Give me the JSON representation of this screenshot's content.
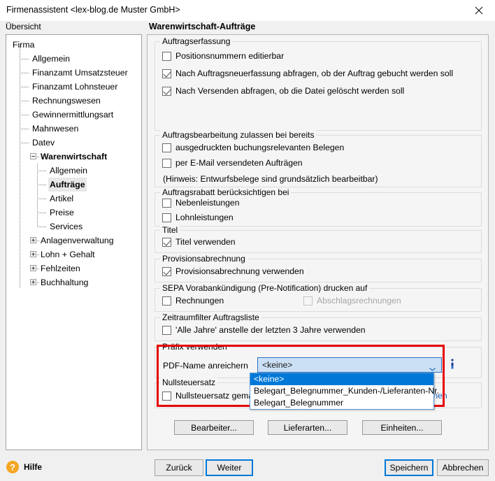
{
  "window": {
    "title": "Firmenassistent <lex-blog.de Muster GmbH>",
    "close_icon": "close-icon"
  },
  "sidebar": {
    "header": "Übersicht",
    "items": [
      {
        "label": "Firma",
        "level": 0,
        "expander": "none",
        "bold": false,
        "selected": false
      },
      {
        "label": "Allgemein",
        "level": 1,
        "expander": "none",
        "bold": false,
        "selected": false
      },
      {
        "label": "Finanzamt Umsatzsteuer",
        "level": 1,
        "expander": "none",
        "bold": false,
        "selected": false
      },
      {
        "label": "Finanzamt Lohnsteuer",
        "level": 1,
        "expander": "none",
        "bold": false,
        "selected": false
      },
      {
        "label": "Rechnungswesen",
        "level": 1,
        "expander": "none",
        "bold": false,
        "selected": false
      },
      {
        "label": "Gewinnermittlungsart",
        "level": 1,
        "expander": "none",
        "bold": false,
        "selected": false
      },
      {
        "label": "Mahnwesen",
        "level": 1,
        "expander": "none",
        "bold": false,
        "selected": false
      },
      {
        "label": "Datev",
        "level": 1,
        "expander": "none",
        "bold": false,
        "selected": false
      },
      {
        "label": "Warenwirtschaft",
        "level": 1,
        "expander": "minus",
        "bold": true,
        "selected": false
      },
      {
        "label": "Allgemein",
        "level": 2,
        "expander": "none",
        "bold": false,
        "selected": false
      },
      {
        "label": "Aufträge",
        "level": 2,
        "expander": "none",
        "bold": true,
        "selected": true
      },
      {
        "label": "Artikel",
        "level": 2,
        "expander": "none",
        "bold": false,
        "selected": false
      },
      {
        "label": "Preise",
        "level": 2,
        "expander": "none",
        "bold": false,
        "selected": false
      },
      {
        "label": "Services",
        "level": 2,
        "expander": "none",
        "bold": false,
        "selected": false
      },
      {
        "label": "Anlagenverwaltung",
        "level": 1,
        "expander": "plus",
        "bold": false,
        "selected": false
      },
      {
        "label": "Lohn + Gehalt",
        "level": 1,
        "expander": "plus",
        "bold": false,
        "selected": false
      },
      {
        "label": "Fehlzeiten",
        "level": 1,
        "expander": "plus",
        "bold": false,
        "selected": false
      },
      {
        "label": "Buchhaltung",
        "level": 1,
        "expander": "plus",
        "bold": false,
        "selected": false
      }
    ]
  },
  "page": {
    "title": "Warenwirtschaft-Aufträge"
  },
  "groups": {
    "auftragserfassung": {
      "title": "Auftragserfassung",
      "options": [
        {
          "label": "Positionsnummern editierbar",
          "checked": false,
          "disabled": false
        },
        {
          "label": "Nach Auftragsneuerfassung abfragen, ob der Auftrag gebucht werden soll",
          "checked": true,
          "disabled": false
        },
        {
          "label": "Nach Versenden abfragen, ob die Datei gelöscht werden soll",
          "checked": true,
          "disabled": false
        }
      ]
    },
    "auftragsbearbeitung": {
      "title": "Auftragsbearbeitung zulassen bei bereits",
      "options": [
        {
          "label": "ausgedruckten buchungsrelevanten Belegen",
          "checked": false,
          "disabled": false
        },
        {
          "label": "per E-Mail versendeten Aufträgen",
          "checked": false,
          "disabled": false
        }
      ],
      "note": "(Hinweis: Entwurfsbelege sind grundsätzlich bearbeitbar)"
    },
    "auftragsrabatt": {
      "title": "Auftragsrabatt berücksichtigen bei",
      "options": [
        {
          "label": "Nebenleistungen",
          "checked": false,
          "disabled": false
        },
        {
          "label": "Lohnleistungen",
          "checked": false,
          "disabled": false
        }
      ]
    },
    "titel": {
      "title": "Titel",
      "options": [
        {
          "label": "Titel verwenden",
          "checked": true,
          "disabled": false
        }
      ]
    },
    "provision": {
      "title": "Provisionsabrechnung",
      "options": [
        {
          "label": "Provisionsabrechnung verwenden",
          "checked": true,
          "disabled": false
        }
      ]
    },
    "sepa": {
      "title": "SEPA Vorabankündigung (Pre-Notification) drucken auf",
      "options": [
        {
          "label": "Rechnungen",
          "checked": false,
          "disabled": false
        },
        {
          "label": "Abschlagsrechnungen",
          "checked": false,
          "disabled": true
        }
      ]
    },
    "zeitraumfilter": {
      "title": "Zeitraumfilter Auftragsliste",
      "options": [
        {
          "label": "'Alle Jahre' anstelle der letzten 3 Jahre verwenden",
          "checked": false,
          "disabled": false
        }
      ]
    },
    "praefix": {
      "title": "Präfix verwenden",
      "field_label": "PDF-Name anreichern",
      "selected_value": "<keine>",
      "options": [
        "<keine>",
        "Belegart_Belegnummer_Kunden-/Lieferanten-Nr.",
        "Belegart_Belegnummer"
      ],
      "info_icon": "info-icon",
      "highlight_color": "#e60000"
    },
    "nullsteuersatz": {
      "title": "Nullsteuersatz",
      "option_label": "Nullsteuersatz gemäß § 12 Abs. 3 UStG berücksichtigen",
      "option_checked": false,
      "link_label": "Informationen"
    }
  },
  "action_buttons": [
    {
      "label": "Bearbeiter..."
    },
    {
      "label": "Lieferarten..."
    },
    {
      "label": "Einheiten..."
    }
  ],
  "footer": {
    "help_label": "Hilfe",
    "help_icon": "question-mark-icon",
    "buttons": [
      {
        "label": "Zurück",
        "focus": false
      },
      {
        "label": "Weiter",
        "focus": true
      },
      {
        "label": "Speichern",
        "focus": true
      },
      {
        "label": "Abbrechen",
        "focus": false
      }
    ]
  }
}
